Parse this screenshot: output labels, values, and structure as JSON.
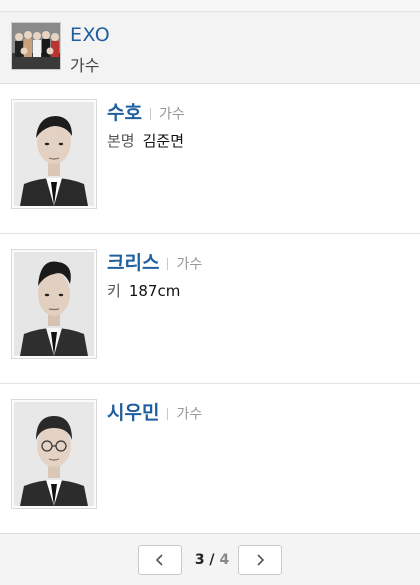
{
  "group": {
    "name": "EXO",
    "subtitle": "가수"
  },
  "members": [
    {
      "name": "수호",
      "role": "가수",
      "detail_label": "본명",
      "detail_value": "김준면"
    },
    {
      "name": "크리스",
      "role": "가수",
      "detail_label": "키",
      "detail_value": "187cm"
    },
    {
      "name": "시우민",
      "role": "가수",
      "detail_label": "",
      "detail_value": ""
    }
  ],
  "pagination": {
    "current": "3",
    "separator": " / ",
    "total": "4"
  },
  "colors": {
    "link": "#1f5f9e",
    "muted": "#999999",
    "header_bg": "#f3f3f3"
  },
  "icons": {
    "prev": "chevron-left-icon",
    "next": "chevron-right-icon"
  }
}
